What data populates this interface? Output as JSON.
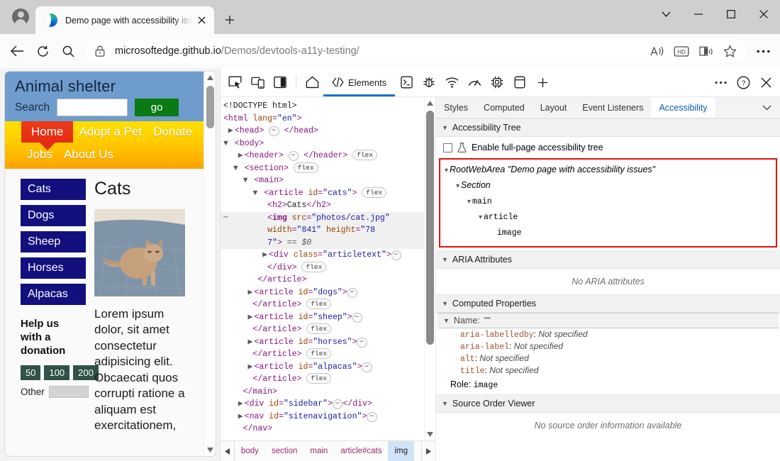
{
  "browser": {
    "tab": {
      "title": "Demo page with accessibility issu",
      "favicon": "edge-logo",
      "close_label": "×"
    },
    "new_tab_label": "+",
    "window_controls": {
      "expand": "⌄",
      "minimize": "–",
      "maximize": "□",
      "close": "✕"
    },
    "address": {
      "lock_icon": "lock-icon",
      "url_host": "microsoftedge.github.io",
      "url_path": "/Demos/devtools-a11y-testing/"
    },
    "toolbar_icons": [
      "read-aloud-icon",
      "hd-badge-icon",
      "immersive-reader-icon",
      "favorite-star-icon",
      "settings-more-icon"
    ],
    "nav_icons": [
      "back-icon",
      "refresh-icon",
      "search-icon"
    ]
  },
  "page": {
    "site_title": "Animal shelter",
    "search": {
      "label": "Search",
      "value": "",
      "button": "go"
    },
    "nav_primary": [
      "Home",
      "Adopt a Pet",
      "Donate"
    ],
    "nav_secondary": [
      "Jobs",
      "About Us"
    ],
    "animal_links": [
      "Cats",
      "Dogs",
      "Sheep",
      "Horses",
      "Alpacas"
    ],
    "donation": {
      "heading": "Help us with a donation",
      "amounts": [
        "50",
        "100",
        "200"
      ],
      "other_label": "Other",
      "other_value": ""
    },
    "article": {
      "heading": "Cats",
      "image_alt": "",
      "text": "Lorem ipsum dolor, sit amet consectetur adipisicing elit. Obcaecati quos corrupti ratione a aliquam est exercitationem,"
    },
    "colors": {
      "header_bg": "#6d9ccd",
      "nav_gradient_start": "#ffe000",
      "nav_gradient_end": "#ffa200",
      "home_red": "#e52b10",
      "go_green": "#0a7a12",
      "animal_navy": "#11107e",
      "donate_green": "#2f5249"
    }
  },
  "devtools": {
    "toolbar": {
      "icons": [
        "inspect-element-icon",
        "device-emulation-icon",
        "dock-side-icon",
        "home-icon"
      ],
      "tabs": [
        {
          "label": "Elements",
          "icon": "elements-icon",
          "active": true
        },
        {
          "label": "Console",
          "icon": "console-icon",
          "active": false
        },
        {
          "label": "Sources",
          "icon": "debugger-icon",
          "active": false
        },
        {
          "label": "Network",
          "icon": "network-icon",
          "active": false
        },
        {
          "label": "Performance",
          "icon": "performance-icon",
          "active": false
        },
        {
          "label": "Memory",
          "icon": "memory-icon",
          "active": false
        },
        {
          "label": "Application",
          "icon": "application-icon",
          "active": false
        }
      ],
      "add_tab_label": "+",
      "more_label": "⋯",
      "help_label": "?",
      "close_label": "✕"
    },
    "dom_tree": [
      {
        "indent": 0,
        "kind": "doctype",
        "text": "<!DOCTYPE html>"
      },
      {
        "indent": 0,
        "kind": "open",
        "tag": "html",
        "attrs": [
          {
            "name": "lang",
            "value": "en"
          }
        ]
      },
      {
        "indent": 0,
        "kind": "collapsed",
        "tag": "head",
        "triangle": "right"
      },
      {
        "indent": 0,
        "kind": "open",
        "tag": "body",
        "triangle": "down"
      },
      {
        "indent": 1,
        "kind": "collapsed",
        "tag": "header",
        "triangle": "right",
        "badge": "flex"
      },
      {
        "indent": 1,
        "kind": "open",
        "tag": "section",
        "triangle": "down",
        "badge": "flex"
      },
      {
        "indent": 2,
        "kind": "open",
        "tag": "main",
        "triangle": "down"
      },
      {
        "indent": 3,
        "kind": "open",
        "tag": "article",
        "triangle": "down",
        "attrs": [
          {
            "name": "id",
            "value": "cats"
          }
        ],
        "badge": "flex"
      },
      {
        "indent": 4,
        "kind": "inline",
        "text": "<h2>Cats</h2>"
      },
      {
        "indent": 4,
        "kind": "selected-img",
        "selected": true
      },
      {
        "indent": 4,
        "kind": "collapsed",
        "tag": "div",
        "triangle": "right",
        "attrs": [
          {
            "name": "class",
            "value": "articletext"
          }
        ]
      },
      {
        "indent": 4,
        "kind": "close",
        "tag": "div",
        "badge": "flex"
      },
      {
        "indent": 3,
        "kind": "close",
        "tag": "article"
      },
      {
        "indent": 3,
        "kind": "collapsed",
        "tag": "article",
        "triangle": "right",
        "attrs": [
          {
            "name": "id",
            "value": "dogs"
          }
        ]
      },
      {
        "indent": 3,
        "kind": "close",
        "tag": "article",
        "badge": "flex"
      },
      {
        "indent": 3,
        "kind": "collapsed",
        "tag": "article",
        "triangle": "right",
        "attrs": [
          {
            "name": "id",
            "value": "sheep"
          }
        ]
      },
      {
        "indent": 3,
        "kind": "close",
        "tag": "article",
        "badge": "flex"
      },
      {
        "indent": 3,
        "kind": "collapsed",
        "tag": "article",
        "triangle": "right",
        "attrs": [
          {
            "name": "id",
            "value": "horses"
          }
        ]
      },
      {
        "indent": 3,
        "kind": "close",
        "tag": "article",
        "badge": "flex"
      },
      {
        "indent": 3,
        "kind": "collapsed",
        "tag": "article",
        "triangle": "right",
        "attrs": [
          {
            "name": "id",
            "value": "alpacas"
          }
        ]
      },
      {
        "indent": 3,
        "kind": "close",
        "tag": "article",
        "badge": "flex"
      },
      {
        "indent": 2,
        "kind": "close",
        "tag": "main"
      },
      {
        "indent": 2,
        "kind": "collapsed-pair",
        "tag": "div",
        "triangle": "right",
        "attrs": [
          {
            "name": "id",
            "value": "sidebar"
          }
        ]
      },
      {
        "indent": 2,
        "kind": "collapsed",
        "tag": "nav",
        "triangle": "right",
        "attrs": [
          {
            "name": "id",
            "value": "sitenavigation"
          }
        ]
      },
      {
        "indent": 2,
        "kind": "close",
        "tag": "nav"
      }
    ],
    "selected_img": {
      "tag": "img",
      "src_name": "src",
      "src_value": "photos/cat.jpg",
      "width_name": "width",
      "width_value": "841",
      "height_name": "height",
      "height_value": "787",
      "suffix": "== $0",
      "gutter": "…"
    },
    "breadcrumbs": {
      "left_arrow": "◀",
      "right_arrow": "▶",
      "items": [
        "body",
        "section",
        "main",
        "article#cats",
        "img"
      ],
      "active": "img"
    },
    "a11y": {
      "tabs": [
        "Styles",
        "Computed",
        "Layout",
        "Event Listeners",
        "Accessibility"
      ],
      "active_tab": "Accessibility",
      "more_label": "⌄",
      "sections": {
        "tree_title": "Accessibility Tree",
        "aria_title": "ARIA Attributes",
        "computed_title": "Computed Properties",
        "source_title": "Source Order Viewer"
      },
      "full_page_checkbox": {
        "label": "Enable full-page accessibility tree",
        "checked": false,
        "icon": "beaker-icon"
      },
      "tree_nodes": [
        {
          "depth": 0,
          "role": "RootWebArea",
          "name": "\"Demo page with accessibility issues\"",
          "italic": true
        },
        {
          "depth": 1,
          "role": "Section",
          "name": "",
          "italic": true
        },
        {
          "depth": 2,
          "role": "main",
          "name": "",
          "italic": false
        },
        {
          "depth": 3,
          "role": "article",
          "name": "",
          "italic": false
        },
        {
          "depth": 4,
          "role": "image",
          "name": "",
          "italic": false,
          "leaf": true
        }
      ],
      "tree_highlight_color": "#e31010",
      "aria_empty": "No ARIA attributes",
      "name_label": "Name:",
      "name_value": "\"\"",
      "computed_props": [
        {
          "key": "aria-labelledby",
          "value": "Not specified"
        },
        {
          "key": "aria-label",
          "value": "Not specified"
        },
        {
          "key": "alt",
          "value": "Not specified"
        },
        {
          "key": "title",
          "value": "Not specified"
        }
      ],
      "role_label": "Role:",
      "role_value": "image",
      "source_empty": "No source order information available"
    }
  }
}
